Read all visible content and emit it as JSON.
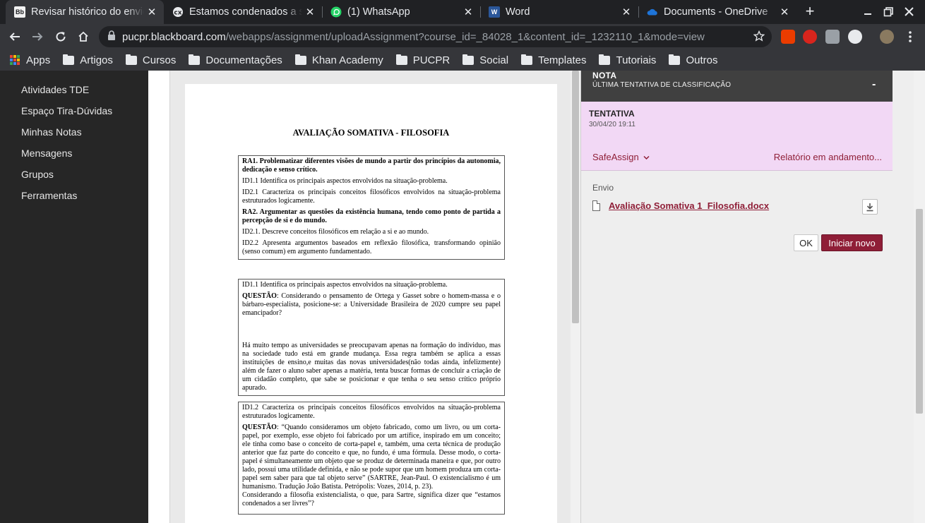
{
  "browser": {
    "tabs": [
      {
        "title": "Revisar histórico do envio",
        "favicon": "blackboard-icon",
        "active": true
      },
      {
        "title": "Estamos condenados a ser livres",
        "favicon": "page-icon",
        "active": false
      },
      {
        "title": "(1) WhatsApp",
        "favicon": "whatsapp-icon",
        "active": false
      },
      {
        "title": "Word",
        "favicon": "word-icon",
        "active": false
      },
      {
        "title": "Documents - OneDrive",
        "favicon": "onedrive-icon",
        "active": false
      }
    ],
    "url_host": "pucpr.blackboard.com",
    "url_rest": "/webapps/assignment/uploadAssignment?course_id=_84028_1&content_id=_1232110_1&mode=view",
    "bookmarks": [
      "Apps",
      "Artigos",
      "Cursos",
      "Documentações",
      "Khan Academy",
      "PUCPR",
      "Social",
      "Templates",
      "Tutoriais",
      "Outros"
    ]
  },
  "nav": {
    "items": [
      "Atividades TDE",
      "Espaço Tira-Dúvidas",
      "Minhas Notas",
      "Mensagens",
      "Grupos",
      "Ferramentas"
    ]
  },
  "document": {
    "title": "AVALIAÇÃO SOMATIVA - FILOSOFIA",
    "box1": {
      "ra1": "RA1. Problematizar diferentes visões de mundo a partir dos princípios da autonomia, dedicação e senso crítico.",
      "id11": "ID1.1 Identifica os principais aspectos envolvidos na situação-problema.",
      "id21": "ID2.1 Caracteriza os principais conceitos filosóficos envolvidos na situação-problema estruturados logicamente.",
      "ra2": "RA2. Argumentar as questões da existência humana, tendo como ponto de partida a percepção de si e do mundo.",
      "id21b": "ID2.1. Descreve conceitos filosóficos em relação a si e ao mundo.",
      "id22": "ID2.2 Apresenta argumentos baseados em reflexão filosófica, transformando opinião (senso comum) em argumento fundamentado."
    },
    "box2": {
      "header": "ID1.1 Identifica os principais aspectos envolvidos na situação-problema.",
      "q_label": "QUESTÃO",
      "q_text": ": Considerando o pensamento de Ortega y Gasset sobre o homem-massa e o bárbaro-especialista, posicione-se: a Universidade Brasileira de 2020 cumpre seu papel emancipador?",
      "answer": "Há muito tempo as universidades se preocupavam apenas na formação do individuo, mas na sociedade tudo está em grande mudança. Essa regra também se aplica a essas instituições de ensino,e muitas das novas universidades(não todas ainda, infelizmente) além de fazer o aluno saber apenas a matéria, tenta buscar formas de concluir a criação de um cidadão completo, que sabe se posicionar e que tenha o seu senso crítico próprio apurado."
    },
    "box3": {
      "header": "ID1.2 Caracteriza os principais conceitos filosóficos envolvidos na situação-problema estruturados logicamente.",
      "q_label": "QUESTÃO",
      "q_text": ": “Quando consideramos um objeto fabricado, como um livro, ou um corta-papel, por exemplo, esse objeto foi fabricado por um artífice, inspirado em um conceito; ele tinha como base o conceito de corta-papel e, também, uma certa técnica de produção anterior que faz parte do conceito e que, no fundo, é uma fórmula. Desse modo, o corta-papel é simultaneamente um objeto que se produz de determinada maneira e que, por outro lado, possui uma utilidade definida, e não se pode supor que um homem produza um corta-papel sem saber para que tal objeto serve” (SARTRE, Jean-Paul. O existencialismo é um humanismo. Tradução João Batista. Petrópolis: Vozes, 2014, p. 23).",
      "q_follow": "Considerando a filosofia existencialista, o que, para Sartre, significa dizer que “estamos condenados a ser livres”?"
    }
  },
  "panel": {
    "grade_title": "NOTA",
    "grade_sub": "ÚLTIMA TENTATIVA DE CLASSIFICAÇÃO",
    "grade_collapse": "-",
    "attempt_label": "TENTATIVA",
    "attempt_date": "30/04/20 19:11",
    "safeassign": "SafeAssign",
    "report": "Relatório em andamento...",
    "envio_label": "Envio",
    "file_name": "Avaliação Somativa 1_Filosofia.docx",
    "ok_label": "OK",
    "new_label": "Iniciar novo"
  },
  "colors": {
    "accent": "#8f1e37",
    "attempt_bg": "#f2d8f5",
    "nav_bg": "#262626",
    "header_bg": "#404040"
  }
}
